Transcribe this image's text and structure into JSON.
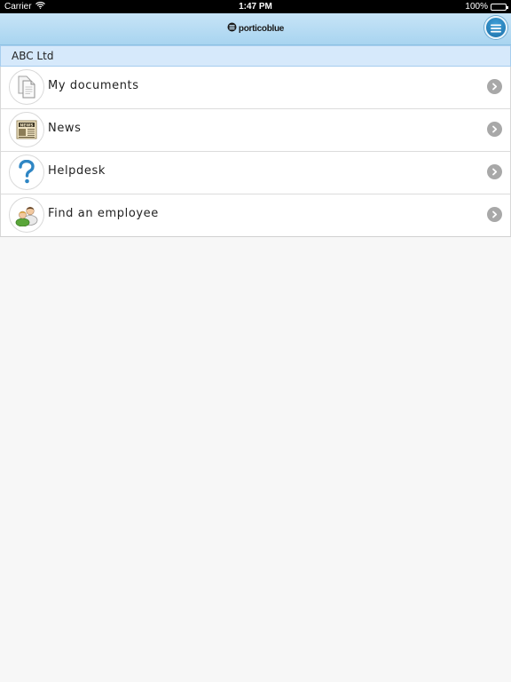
{
  "status_bar": {
    "carrier": "Carrier",
    "time": "1:47 PM",
    "battery": "100%"
  },
  "nav": {
    "logo_text": "porticoblue",
    "menu_icon": "hamburger-menu-icon"
  },
  "company": {
    "name": "ABC Ltd"
  },
  "menu_items": [
    {
      "label": "My documents",
      "icon": "documents-icon"
    },
    {
      "label": "News",
      "icon": "newspaper-icon"
    },
    {
      "label": "Helpdesk",
      "icon": "question-mark-icon"
    },
    {
      "label": "Find an employee",
      "icon": "employees-icon"
    }
  ],
  "colors": {
    "nav_background": "#b3dbf4",
    "header_background": "#d6e9fb",
    "menu_button": "#1b6fa8",
    "chevron": "#a8a8a8",
    "page_background": "#f7f7f7"
  }
}
